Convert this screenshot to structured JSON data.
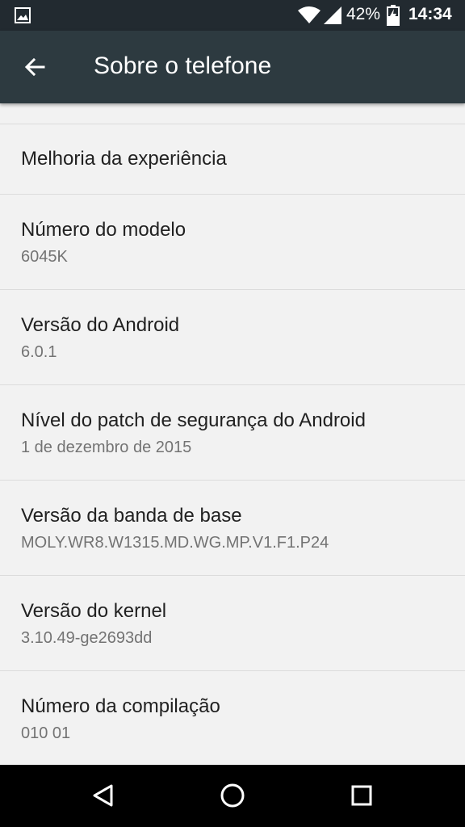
{
  "status_bar": {
    "battery_percent": "42%",
    "time": "14:34",
    "icons": [
      "image-notification-icon",
      "wifi-icon",
      "cell-signal-icon",
      "battery-charging-icon"
    ]
  },
  "toolbar": {
    "title": "Sobre o telefone",
    "back_icon": "arrow-back-icon"
  },
  "items": [
    {
      "title": "Melhoria da experiência"
    },
    {
      "title": "Número do modelo",
      "summary": "6045K"
    },
    {
      "title": "Versão do Android",
      "summary": "6.0.1"
    },
    {
      "title": "Nível do patch de segurança do Android",
      "summary": "1 de dezembro de 2015"
    },
    {
      "title": "Versão da banda de base",
      "summary": "MOLY.WR8.W1315.MD.WG.MP.V1.F1.P24"
    },
    {
      "title": "Versão do kernel",
      "summary": "3.10.49-ge2693dd"
    },
    {
      "title": "Número da compilação",
      "summary": "010 01"
    }
  ],
  "nav_bar": {
    "icons": [
      "back-triangle-icon",
      "home-circle-icon",
      "recents-square-icon"
    ]
  },
  "colors": {
    "status_bar": "#222a30",
    "toolbar": "#2d3a40",
    "background": "#f2f2f2",
    "title_text": "#212121",
    "summary_text": "#737373",
    "divider": "#dcdcdc"
  }
}
